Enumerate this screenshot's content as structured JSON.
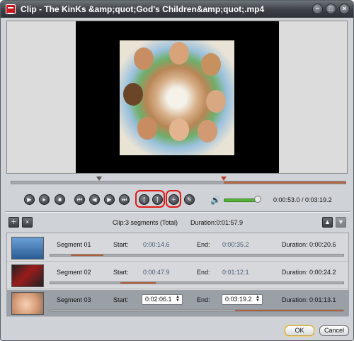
{
  "window": {
    "title": "Clip - The KinKs &amp;quot;God's Children&amp;quot;.mp4"
  },
  "titlebar_buttons": [
    {
      "name": "minimize-button",
      "glyph": "−"
    },
    {
      "name": "maximize-button",
      "glyph": "□"
    },
    {
      "name": "close-button",
      "glyph": "×"
    }
  ],
  "player": {
    "timecode": "0:00:53.0 / 0:03:19.2",
    "volume_level": 0.85
  },
  "clip_bar": {
    "info": "Clip:3 segments (Total)",
    "duration": "Duration:0:01:57.9"
  },
  "labels": {
    "start": "Start:",
    "end": "End:"
  },
  "segments": [
    {
      "name": "Segment 01",
      "start": "0:00:14.6",
      "end": "0:00:35.2",
      "duration": "Duration: 0:00:20.6",
      "thumb_color": "#3a6ea8",
      "progress_start": 0.07,
      "progress_end": 0.18
    },
    {
      "name": "Segment 02",
      "start": "0:00:47.9",
      "end": "0:01:12.1",
      "duration": "Duration: 0:00:24.2",
      "thumb_color": "#8b1e1e",
      "progress_start": 0.24,
      "progress_end": 0.36
    },
    {
      "name": "Segment 03",
      "start": "0:02:06.1",
      "end": "0:03:19.2",
      "duration": "Duration: 0:01:13.1",
      "thumb_color": "#e9b89a",
      "progress_start": 0.63,
      "progress_end": 1.0
    }
  ],
  "buttons": {
    "ok": "OK",
    "cancel": "Cancel"
  },
  "colors": {
    "accent": "#b05f3d",
    "volume": "#58b53a",
    "highlight": "#e01818"
  }
}
